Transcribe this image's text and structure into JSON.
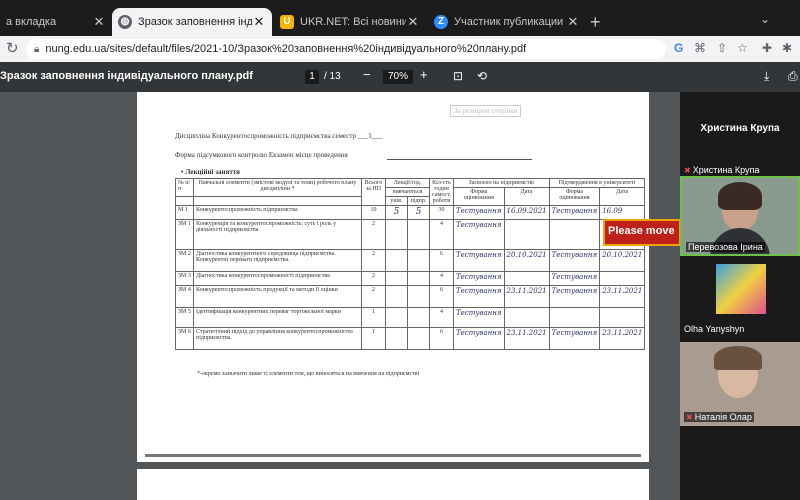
{
  "tabs": [
    {
      "label": "а вкладка",
      "icon": "blank-page-icon"
    },
    {
      "label": "Зразок заповнення індивідуально",
      "icon": "globe-icon"
    },
    {
      "label": "UKR.NET: Всі новини України, ос",
      "icon": "ukrnet-icon"
    },
    {
      "label": "Участник публикации - Zoom",
      "icon": "zoom-icon"
    }
  ],
  "address": {
    "url": "nung.edu.ua/sites/default/files/2021-10/Зразок%20заповнення%20індивідуального%20плану.pdf"
  },
  "pdf_toolbar": {
    "title": "Зразок заповнення індивідуального плану.pdf",
    "page_current": "1",
    "page_total": "/ 13",
    "zoom": "70%",
    "zoom_out": "−",
    "zoom_in": "+"
  },
  "document": {
    "banner": "За розміром сторінки",
    "discipline_line": "Дисципліна  Конкурентоспроможність підприємства  семестр ___1___",
    "control_line": "Форма підсумкового контролю  Екзамен  місце проведення",
    "section_title": "•  Лекційні заняття",
    "headers": {
      "num": "№ п/п",
      "elements": "Навчальні елементи (змістові модулі та теми) робочого плану дисципліни *",
      "total": "Всього за НП",
      "lectures": "Лекції/год.",
      "taught": "вивчаються",
      "group": "унів.",
      "sub": "підпр.",
      "self": "Кіл-сть годин самост. роботи",
      "mastered": "Засвоєно на підприємстві",
      "form": "Форма оцінювання",
      "date": "Дата",
      "confirm": "Підтвердження в університеті",
      "form2": "Форма оцінювання",
      "date2": "Дата"
    },
    "rows": [
      {
        "num": "М 1",
        "name": "Конкурентоспроможність підприємства",
        "total": "10",
        "u": "5",
        "p": "5",
        "self": "30",
        "f1": "Тестування",
        "d1": "16.09.2021",
        "f2": "Тестування",
        "d2": "16.09"
      },
      {
        "num": "ЗМ 1",
        "name": "Конкуренція та конкурентоспроможність: суть і роль у діяльності підприємства",
        "total": "2",
        "u": "",
        "p": "",
        "self": "4",
        "f1": "Тестування",
        "d1": "",
        "f2": "",
        "d2": ""
      },
      {
        "num": "ЗМ 2",
        "name": "Діагностика конкурентного середовища підприємства. Конкурентні переваги підприємства.",
        "total": "2",
        "u": "",
        "p": "",
        "self": "6",
        "f1": "Тестування",
        "d1": "20.10.2021",
        "f2": "Тестування",
        "d2": "20.10.2021"
      },
      {
        "num": "ЗМ 3",
        "name": "Діагностика конкурентоспроможності підприємства",
        "total": "2",
        "u": "",
        "p": "",
        "self": "4",
        "f1": "Тестування",
        "d1": "",
        "f2": "Тестування",
        "d2": ""
      },
      {
        "num": "ЗМ 4",
        "name": "Конкурентоспроможність продукції та методи її оцінки",
        "total": "2",
        "u": "",
        "p": "",
        "self": "6",
        "f1": "Тестування",
        "d1": "23.11.2021",
        "f2": "Тестування",
        "d2": "23.11.2021"
      },
      {
        "num": "ЗМ 5",
        "name": "Ідентифікація конкурентних переваг торговельної марки",
        "total": "1",
        "u": "",
        "p": "",
        "self": "4",
        "f1": "Тестування",
        "d1": "",
        "f2": "",
        "d2": ""
      },
      {
        "num": "ЗМ 6",
        "name": "Стратегічний підхід до управління конкурентоспроможністю підприємства.",
        "total": "1",
        "u": "",
        "p": "",
        "self": "6",
        "f1": "Тестування",
        "d1": "23.11.2021",
        "f2": "Тестування",
        "d2": "23.11.2021"
      }
    ],
    "footnote": "*-окремо зазначити лише ті елементи тем, що виносяться на вивчення на підприємстві"
  },
  "zoom_panel": {
    "host_name": "Христина Крупа",
    "participants": [
      {
        "name": "Христина Крупа",
        "muted": true
      },
      {
        "name": "Перевозова Ірина",
        "muted": false
      },
      {
        "name": "Olha Yanyshyn",
        "muted": false
      },
      {
        "name": "Наталія Олар",
        "muted": true
      }
    ],
    "notice": "Please move"
  },
  "colors": {
    "accent": "#c0201a",
    "tab_bar": "#1c1c1c",
    "pdf_toolbar": "#323639",
    "handwriting": "#2b2f6e"
  }
}
